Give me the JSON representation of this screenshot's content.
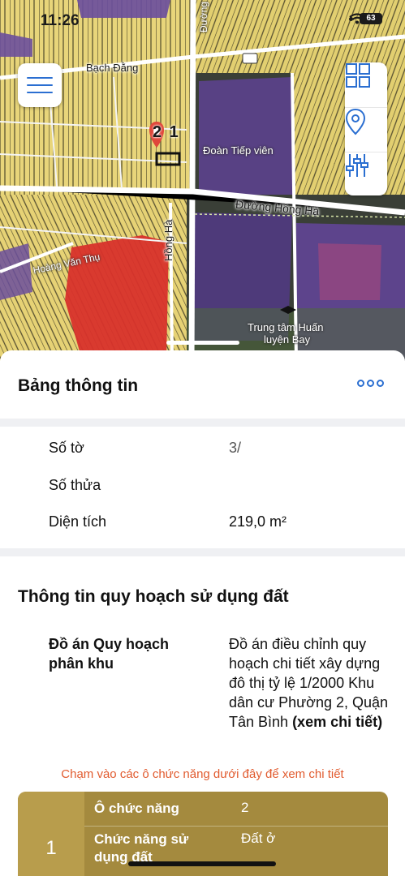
{
  "status": {
    "time": "11:26",
    "battery": "63"
  },
  "map": {
    "labels": {
      "bach_dang": "Bạch Đằng",
      "doan_tiep_vien": "Đoàn Tiếp viên",
      "duong_hong_ha": "Đường Hồng Hà",
      "hong_ha": "Hồng Hà",
      "hoang_van_the": "Hoàng Văn Thụ",
      "trung_tam_1": "Trung tâm Huấn",
      "trung_tam_2": "luyện Bay",
      "top_road": "Đường"
    },
    "pin_number": "2 1",
    "colors": {
      "residential": "#e8d57a",
      "public": "#6b4f9c",
      "highlight": "#d8312b"
    },
    "icons": {
      "menu": "hamburger-icon",
      "layers": "grid-icon",
      "location": "location-pin-icon",
      "filter": "sliders-icon"
    }
  },
  "sheet": {
    "title": "Bảng thông tin",
    "rows": [
      {
        "label": "Số tờ",
        "value": "3/"
      },
      {
        "label": "Số thửa",
        "value": ""
      },
      {
        "label": "Diện tích",
        "value": "219,0 m²"
      }
    ],
    "section_title": "Thông tin quy hoạch sử dụng đất",
    "plan": {
      "label": "Đồ án Quy hoạch phân khu",
      "value": "Đồ án điều chỉnh quy hoạch chi tiết xây dựng đô thị tỷ lệ 1/2000 Khu dân cư Phường 2, Quận Tân Bình",
      "link": "(xem chi tiết)"
    },
    "hint": "Chạm vào các ô chức năng dưới đây để xem chi tiết",
    "card": {
      "index": "1",
      "k1": "Ô chức năng",
      "v1": "2",
      "k2": "Chức năng sử dụng đất",
      "v2": "Đất ở",
      "color": "#a48a3e"
    }
  }
}
